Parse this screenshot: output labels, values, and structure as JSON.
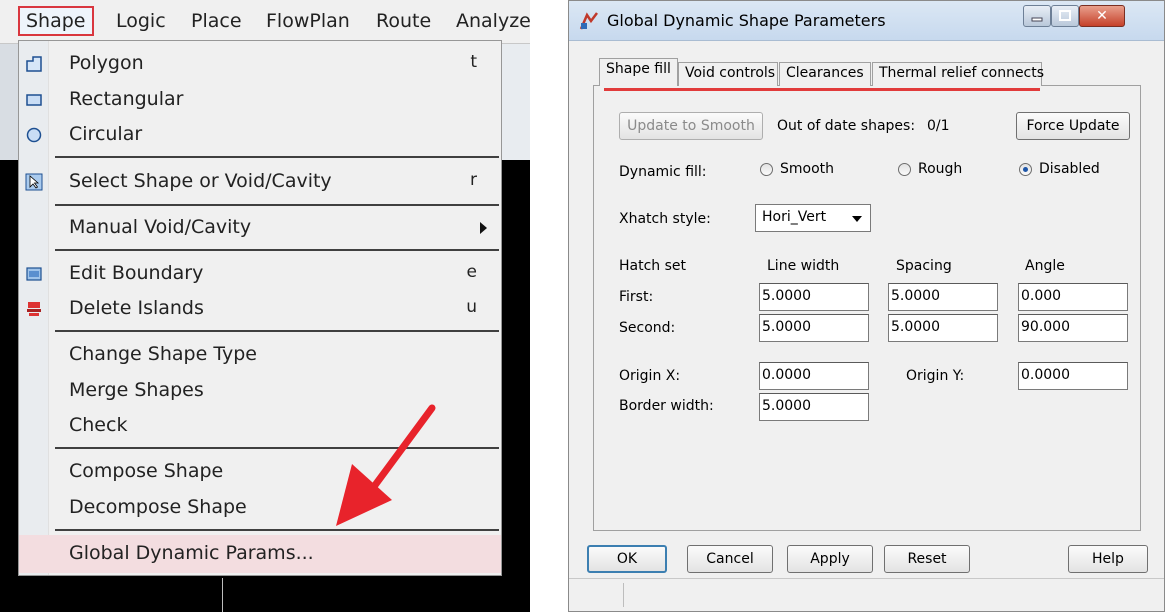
{
  "menubar": {
    "items": [
      "Shape",
      "Logic",
      "Place",
      "FlowPlan",
      "Route",
      "Analyze"
    ]
  },
  "menu": {
    "items": [
      {
        "label": "Polygon",
        "shortcut": "t"
      },
      {
        "label": "Rectangular",
        "shortcut": ""
      },
      {
        "label": "Circular",
        "shortcut": ""
      },
      {
        "label": "Select Shape or Void/Cavity",
        "shortcut": "r"
      },
      {
        "label": "Manual Void/Cavity",
        "shortcut": ""
      },
      {
        "label": "Edit Boundary",
        "shortcut": "e"
      },
      {
        "label": "Delete Islands",
        "shortcut": "u"
      },
      {
        "label": "Change Shape Type",
        "shortcut": ""
      },
      {
        "label": "Merge Shapes",
        "shortcut": ""
      },
      {
        "label": "Check",
        "shortcut": ""
      },
      {
        "label": "Compose Shape",
        "shortcut": ""
      },
      {
        "label": "Decompose Shape",
        "shortcut": ""
      },
      {
        "label": "Global Dynamic Params...",
        "shortcut": ""
      }
    ]
  },
  "dialog": {
    "title": "Global Dynamic Shape Parameters",
    "tabs": [
      "Shape fill",
      "Void controls",
      "Clearances",
      "Thermal relief connects"
    ],
    "update_button": "Update to Smooth",
    "out_of_date_label": "Out of date shapes:",
    "out_of_date_value": "0/1",
    "force_update_button": "Force Update",
    "dynamic_fill_label": "Dynamic fill:",
    "fill_options": [
      "Smooth",
      "Rough",
      "Disabled"
    ],
    "fill_selected": "Disabled",
    "xhatch_label": "Xhatch style:",
    "xhatch_value": "Hori_Vert",
    "hatch_set_label": "Hatch set",
    "col_line_width": "Line width",
    "col_spacing": "Spacing",
    "col_angle": "Angle",
    "first_label": "First:",
    "first": {
      "line_width": "5.0000",
      "spacing": "5.0000",
      "angle": "0.000"
    },
    "second_label": "Second:",
    "second": {
      "line_width": "5.0000",
      "spacing": "5.0000",
      "angle": "90.000"
    },
    "origin_x_label": "Origin X:",
    "origin_x": "0.0000",
    "origin_y_label": "Origin Y:",
    "origin_y": "0.0000",
    "border_width_label": "Border width:",
    "border_width": "5.0000",
    "buttons": {
      "ok": "OK",
      "cancel": "Cancel",
      "apply": "Apply",
      "reset": "Reset",
      "help": "Help"
    }
  },
  "colors": {
    "highlight_red": "#e13b3b",
    "menu_highlight": "#f3dde0"
  }
}
